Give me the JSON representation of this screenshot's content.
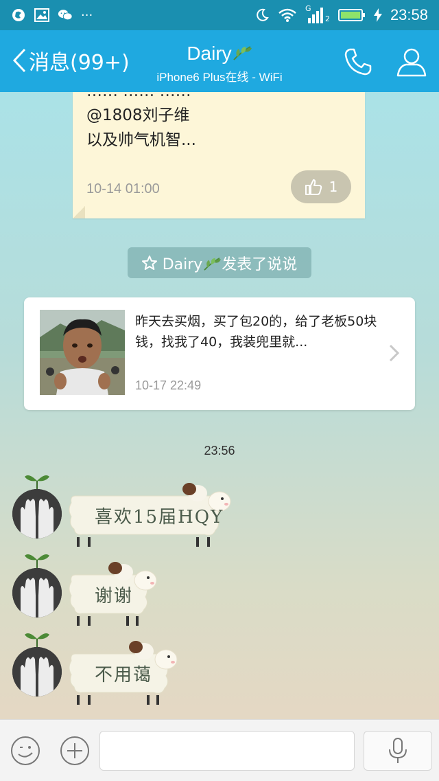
{
  "status_bar": {
    "time": "23:58",
    "left_icons": [
      "browser-icon",
      "image-icon",
      "wechat-icon",
      "more-dots-icon"
    ],
    "more": "···",
    "right_icons": [
      "moon-icon",
      "wifi-icon",
      "signal-icon",
      "battery-icon",
      "charging-icon"
    ],
    "signal_label": "G",
    "sim": "2"
  },
  "header": {
    "back_label": "消息(99+)",
    "title": "Dairy",
    "subtitle": "iPhone6 Plus在线 - WiFi",
    "accent": "#1fa9e0"
  },
  "note_card": {
    "cut_line": "…… …… ……",
    "line1": "@1808刘子维",
    "line2": "以及帅气机智...",
    "time": "10-14 01:00",
    "likes": "1"
  },
  "notice": {
    "pre": "Dairy",
    "post": "发表了说说"
  },
  "feed_card": {
    "text": "昨天去买烟，买了包20的，给了老板50块钱，找我了40，我装兜里就...",
    "time": "10-17 22:49"
  },
  "chat_time": "23:56",
  "messages": [
    {
      "text": "喜欢15届HQY"
    },
    {
      "text": "谢谢"
    },
    {
      "text": "不用蔼"
    }
  ],
  "input": {
    "placeholder": ""
  }
}
